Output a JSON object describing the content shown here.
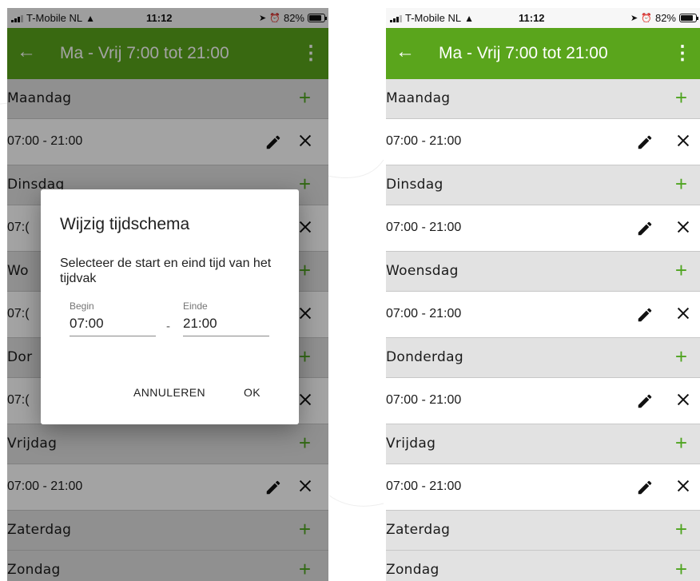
{
  "status_bar": {
    "carrier": "T-Mobile NL",
    "time": "11:12",
    "battery_text": "82%",
    "battery_level": 0.82
  },
  "app_bar": {
    "title": "Ma - Vrij 7:00 tot 21:00",
    "back_icon": "arrow-left-icon",
    "menu_icon": "more-vert-icon",
    "color": "#5aa51c"
  },
  "days": [
    {
      "name": "Maandag",
      "slot": "07:00 - 21:00"
    },
    {
      "name": "Dinsdag",
      "slot": "07:00 - 21:00"
    },
    {
      "name": "Woensdag",
      "slot": "07:00 - 21:00"
    },
    {
      "name": "Donderdag",
      "slot": "07:00 - 21:00"
    },
    {
      "name": "Vrijdag",
      "slot": "07:00 - 21:00"
    },
    {
      "name": "Zaterdag",
      "slot": null
    },
    {
      "name": "Zondag",
      "slot": null
    }
  ],
  "left_visible_prefix": {
    "Dinsdag": "Dinsdag",
    "Woensdag": "Wo",
    "Donderdag": "Dor",
    "slot_prefix": "07:("
  },
  "dialog": {
    "title": "Wijzig tijdschema",
    "text": "Selecteer de start en eind tijd van het tijdvak",
    "begin_label": "Begin",
    "begin_value": "07:00",
    "end_label": "Einde",
    "end_value": "21:00",
    "separator": "-",
    "cancel_label": "ANNULEREN",
    "ok_label": "OK"
  },
  "colors": {
    "accent_green": "#4fa420",
    "day_row_bg": "#e2e2e2"
  }
}
